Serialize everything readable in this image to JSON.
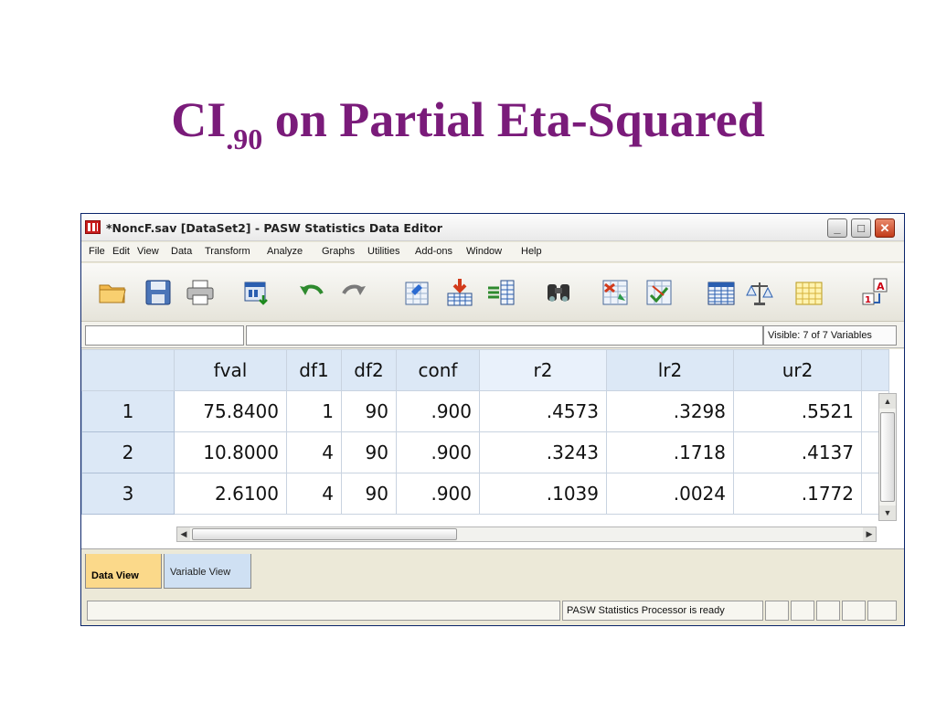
{
  "slide": {
    "title_main": "CI",
    "title_sub": ".90",
    "title_rest": " on Partial Eta-Squared"
  },
  "window": {
    "title": "*NoncF.sav [DataSet2] - PASW Statistics Data Editor",
    "minimize": "_",
    "maximize": "□",
    "close": "✕"
  },
  "menu": [
    "File",
    "Edit",
    "View",
    "Data",
    "Transform",
    "Analyze",
    "Graphs",
    "Utilities",
    "Add-ons",
    "Window",
    "Help"
  ],
  "toolbar": {
    "icons": [
      "open-folder-icon",
      "save-icon",
      "print-icon",
      "recall-dialog-icon",
      "undo-icon",
      "redo-icon",
      "goto-case-icon",
      "goto-variable-icon",
      "variables-icon",
      "find-icon",
      "insert-cases-icon",
      "insert-variable-icon",
      "split-file-icon",
      "weight-cases-icon",
      "select-cases-icon",
      "value-labels-icon"
    ]
  },
  "cellbar": {
    "visible_text": "Visible: 7 of 7 Variables"
  },
  "grid": {
    "columns": [
      "fval",
      "df1",
      "df2",
      "conf",
      "r2",
      "lr2",
      "ur2"
    ],
    "rows": [
      {
        "num": "1",
        "cells": [
          "75.8400",
          "1",
          "90",
          ".900",
          ".4573",
          ".3298",
          ".5521"
        ]
      },
      {
        "num": "2",
        "cells": [
          "10.8000",
          "4",
          "90",
          ".900",
          ".3243",
          ".1718",
          ".4137"
        ]
      },
      {
        "num": "3",
        "cells": [
          "2.6100",
          "4",
          "90",
          ".900",
          ".1039",
          ".0024",
          ".1772"
        ]
      }
    ]
  },
  "tabs": {
    "data_view": "Data View",
    "variable_view": "Variable View"
  },
  "status": {
    "message": "PASW Statistics Processor is ready"
  },
  "colors": {
    "title": "#7a1b7a",
    "header_bg": "#dce8f6",
    "active_tab": "#fbd98a"
  }
}
